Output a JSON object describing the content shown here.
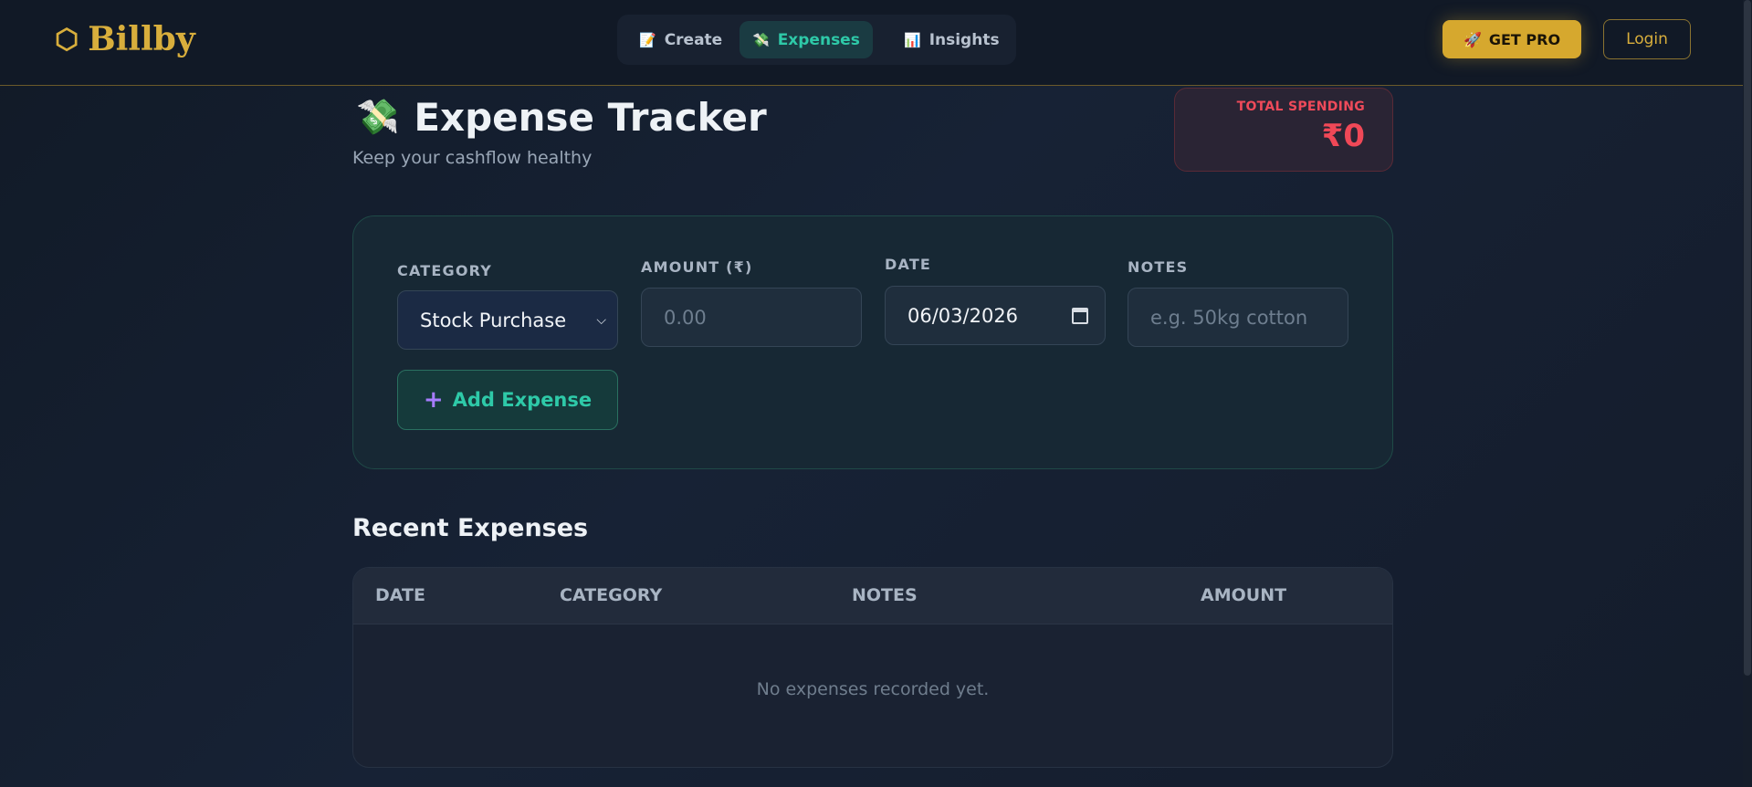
{
  "brand": {
    "name": "Billby",
    "logo_glyph": "⬡"
  },
  "nav": {
    "tabs": [
      {
        "label": "Create",
        "icon": "📝"
      },
      {
        "label": "Expenses",
        "icon": "💸",
        "active": true
      },
      {
        "label": "Insights",
        "icon": "📊"
      }
    ]
  },
  "header_actions": {
    "pro_label": "GET PRO",
    "pro_icon": "🚀",
    "login_label": "Login"
  },
  "page": {
    "title": "Expense Tracker",
    "title_icon": "💸",
    "subtitle": "Keep your cashflow healthy"
  },
  "total": {
    "label": "TOTAL SPENDING",
    "value": "₹0"
  },
  "form": {
    "category_label": "CATEGORY",
    "category_value": "Stock Purchase",
    "amount_label": "AMOUNT (₹)",
    "amount_placeholder": "0.00",
    "date_label": "DATE",
    "date_value": "06/03/2026",
    "notes_label": "NOTES",
    "notes_placeholder": "e.g. 50kg cotton",
    "add_label": "Add Expense",
    "add_icon": "+"
  },
  "recent": {
    "title": "Recent Expenses",
    "columns": [
      "DATE",
      "CATEGORY",
      "NOTES",
      "AMOUNT"
    ],
    "empty_message": "No expenses recorded yet."
  },
  "colors": {
    "accent_teal": "#2ec9a8",
    "gold": "#d8ae3c",
    "danger": "#f04857"
  }
}
